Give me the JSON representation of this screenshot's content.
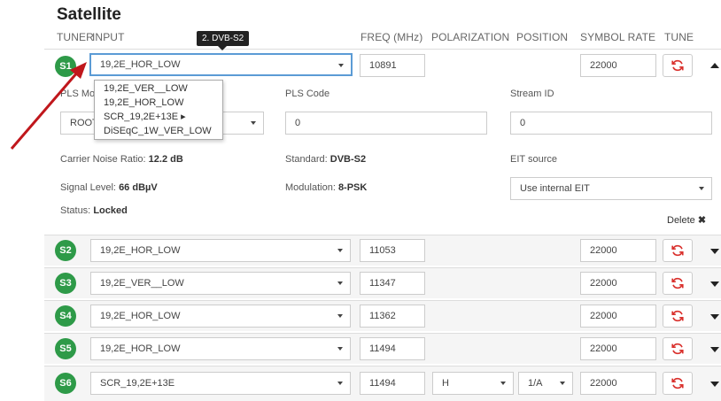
{
  "title": "Satellite",
  "headers": {
    "tuner": "TUNER",
    "input": "INPUT",
    "freq": "FREQ (MHz)",
    "polarization": "POLARIZATION",
    "position": "POSITION",
    "symbol_rate": "SYMBOL RATE",
    "tune": "TUNE"
  },
  "tooltip": "2. DVB-S2",
  "rows": [
    {
      "id": "S1",
      "input": "19,2E_HOR_LOW",
      "freq": "10891",
      "symbol_rate": "22000"
    },
    {
      "id": "S2",
      "input": "19,2E_HOR_LOW",
      "freq": "11053",
      "symbol_rate": "22000"
    },
    {
      "id": "S3",
      "input": "19,2E_VER__LOW",
      "freq": "11347",
      "symbol_rate": "22000"
    },
    {
      "id": "S4",
      "input": "19,2E_HOR_LOW",
      "freq": "11362",
      "symbol_rate": "22000"
    },
    {
      "id": "S5",
      "input": "19,2E_HOR_LOW",
      "freq": "11494",
      "symbol_rate": "22000"
    },
    {
      "id": "S6",
      "input": "SCR_19,2E+13E",
      "freq": "11494",
      "polarization": "H",
      "position": "1/A",
      "symbol_rate": "22000"
    }
  ],
  "dropdown_options": [
    "19,2E_VER__LOW",
    "19,2E_HOR_LOW",
    "SCR_19,2E+13E ▸",
    "DiSEqC_1W_VER_LOW"
  ],
  "detail": {
    "pls_mode_label": "PLS Mo",
    "pls_mode_value": "ROOT",
    "pls_code_label": "PLS Code",
    "pls_code_value": "0",
    "stream_id_label": "Stream ID",
    "stream_id_value": "0",
    "cnr_label": "Carrier Noise Ratio:",
    "cnr_value": "12.2 dB",
    "standard_label": "Standard:",
    "standard_value": "DVB-S2",
    "eit_label": "EIT source",
    "eit_value": "Use internal EIT",
    "signal_label": "Signal Level:",
    "signal_value": "66 dBµV",
    "modulation_label": "Modulation:",
    "modulation_value": "8-PSK",
    "status_label": "Status:",
    "status_value": "Locked",
    "delete_label": "Delete"
  },
  "colors": {
    "badge": "#2e9a48",
    "tune_icon": "#d9302c",
    "arrow": "#c0171c",
    "focus": "#5b9bd5"
  }
}
